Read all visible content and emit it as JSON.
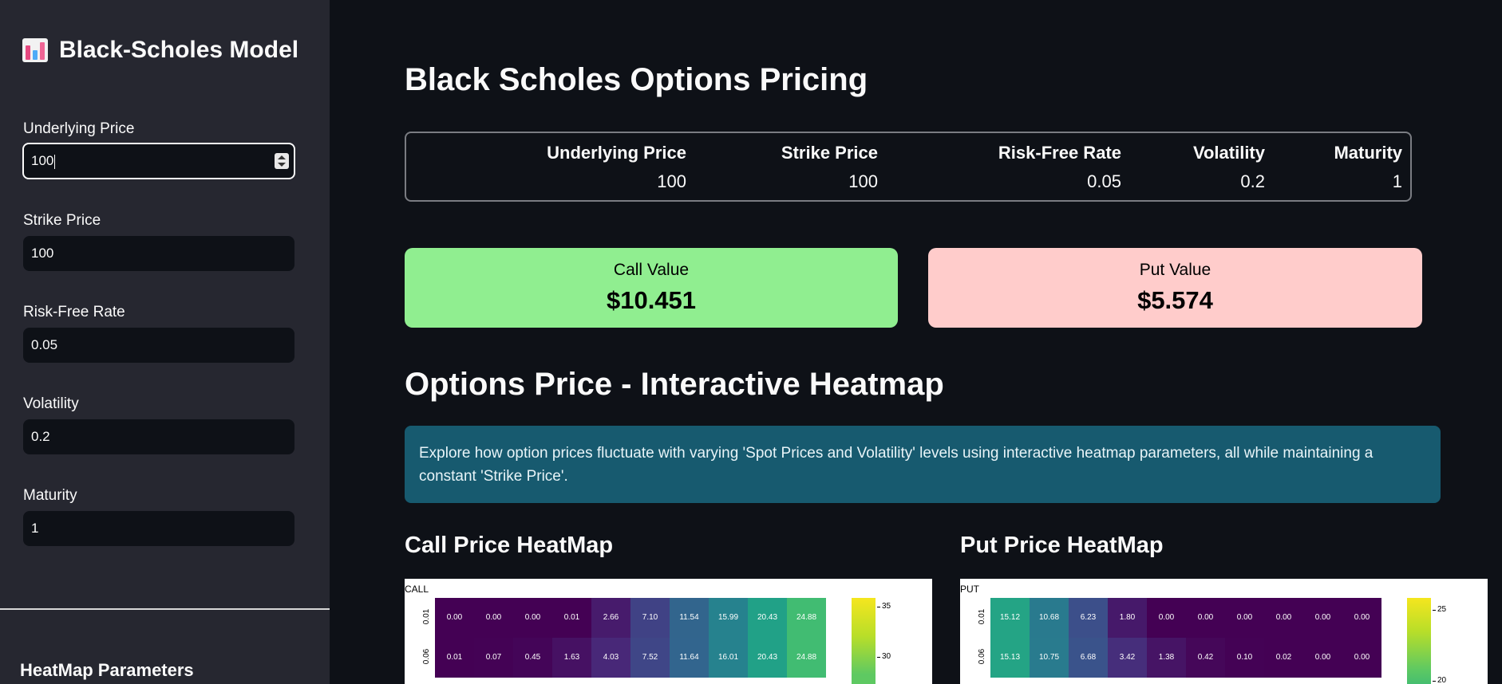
{
  "sidebar": {
    "title": "Black-Scholes Model",
    "fields": [
      {
        "label": "Underlying Price",
        "value": "100"
      },
      {
        "label": "Strike Price",
        "value": "100"
      },
      {
        "label": "Risk-Free Rate",
        "value": "0.05"
      },
      {
        "label": "Volatility",
        "value": "0.2"
      },
      {
        "label": "Maturity",
        "value": "1"
      }
    ],
    "heatmap_section": "HeatMap Parameters"
  },
  "main": {
    "title": "Black Scholes Options Pricing",
    "params": [
      {
        "header": "Underlying Price",
        "value": "100"
      },
      {
        "header": "Strike Price",
        "value": "100"
      },
      {
        "header": "Risk-Free Rate",
        "value": "0.05"
      },
      {
        "header": "Volatility",
        "value": "0.2"
      },
      {
        "header": "Maturity",
        "value": "1"
      }
    ],
    "call": {
      "label": "Call Value",
      "value": "$10.451",
      "color": "#90ee90"
    },
    "put": {
      "label": "Put Value",
      "value": "$5.574",
      "color": "#ffcccb"
    },
    "heatmap_title": "Options Price - Interactive Heatmap",
    "info": "Explore how option prices fluctuate with varying 'Spot Prices and Volatility' levels using interactive heatmap parameters, all while maintaining a constant 'Strike Price'.",
    "call_heatmap_title": "Call Price HeatMap",
    "put_heatmap_title": "Put Price HeatMap"
  },
  "chart_data": [
    {
      "type": "heatmap",
      "title": "CALL",
      "y_labels": [
        "0.01",
        "0.06"
      ],
      "rows": [
        [
          0.0,
          0.0,
          0.0,
          0.01,
          2.66,
          7.1,
          11.54,
          15.99,
          20.43,
          24.88
        ],
        [
          0.01,
          0.07,
          0.45,
          1.63,
          4.03,
          7.52,
          11.64,
          16.01,
          20.43,
          24.88
        ]
      ],
      "colorbar_ticks": [
        "35",
        "30"
      ]
    },
    {
      "type": "heatmap",
      "title": "PUT",
      "y_labels": [
        "0.01",
        "0.06"
      ],
      "rows": [
        [
          15.12,
          10.68,
          6.23,
          1.8,
          0.0,
          0.0,
          0.0,
          0.0,
          0.0,
          0.0
        ],
        [
          15.13,
          10.75,
          6.68,
          3.42,
          1.38,
          0.42,
          0.1,
          0.02,
          0.0,
          0.0
        ]
      ],
      "colorbar_ticks": [
        "25",
        "20"
      ]
    }
  ]
}
